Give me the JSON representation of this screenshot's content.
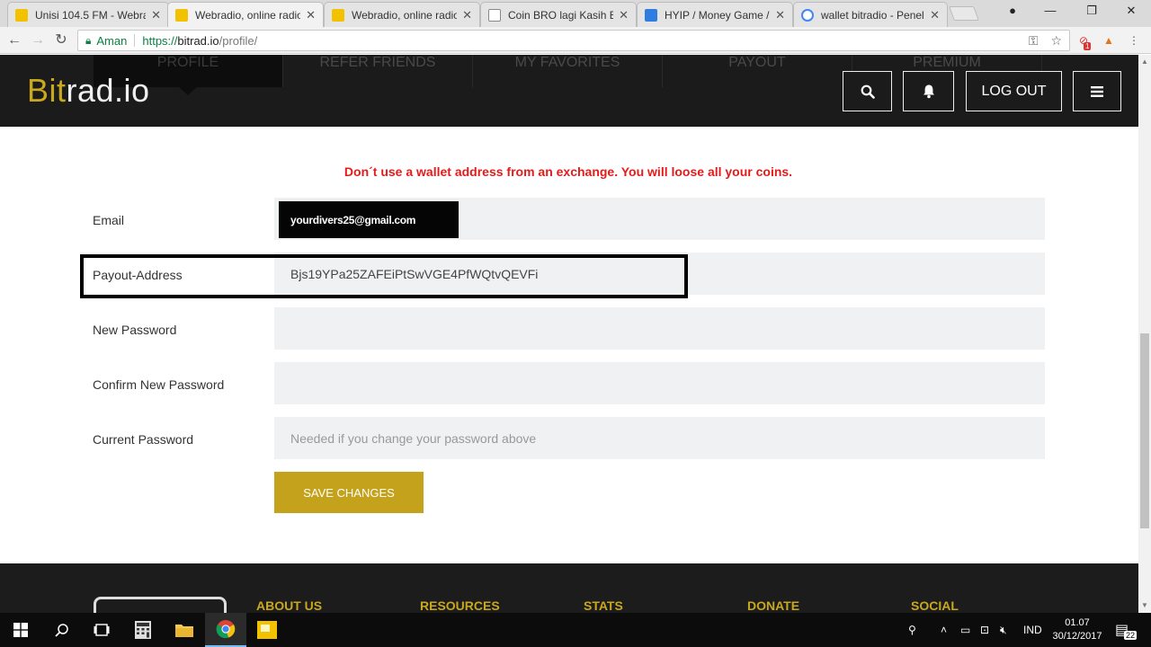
{
  "browser": {
    "tabs": [
      {
        "title": "Unisi 104.5 FM - Webra",
        "icon": "radio-favicon",
        "color": "#f2c200"
      },
      {
        "title": "Webradio, online radio",
        "icon": "bitrad-favicon",
        "color": "#f2c200"
      },
      {
        "title": "Webradio, online radio",
        "icon": "bitrad-favicon",
        "color": "#f2c200"
      },
      {
        "title": "Coin BRO lagi Kasih Bo",
        "icon": "page-favicon",
        "color": "#ffffff"
      },
      {
        "title": "HYIP / Money Game / F",
        "icon": "k-favicon",
        "color": "#2f7de1"
      },
      {
        "title": "wallet bitradio - Penelu",
        "icon": "google-favicon",
        "color": "#4285f4"
      }
    ],
    "address": {
      "secure_label": "Aman",
      "url_proto": "https://",
      "url_host": "bitrad.io",
      "url_path": "/profile/"
    },
    "extension_badge": "1"
  },
  "site": {
    "logo_prefix": "Bit",
    "logo_suffix": "rad.io",
    "subnav": [
      "PROFILE",
      "REFER FRIENDS",
      "MY FAVORITES",
      "PAYOUT",
      "PREMIUM"
    ],
    "logout_label": "LOG OUT"
  },
  "form": {
    "warning": "Don´t use a wallet address from an exchange. You will loose all your coins.",
    "email_label": "Email",
    "email_value": "yourdivers25@gmail.com",
    "payout_label": "Payout-Address",
    "payout_value": "Bjs19YPa25ZAFEiPtSwVGE4PfWQtvQEVFi",
    "new_password_label": "New Password",
    "confirm_password_label": "Confirm New Password",
    "current_password_label": "Current Password",
    "current_password_placeholder": "Needed if you change your password above",
    "save_label": "SAVE CHANGES"
  },
  "footer": {
    "headings": [
      "ABOUT US",
      "RESOURCES",
      "STATS",
      "DONATE",
      "SOCIAL"
    ]
  },
  "taskbar": {
    "language": "IND",
    "time": "01.07",
    "date": "30/12/2017",
    "notification_count": "22"
  },
  "colors": {
    "accent": "#c5a21b",
    "warning": "#e31b1b",
    "header_bg": "#1b1b1b"
  }
}
